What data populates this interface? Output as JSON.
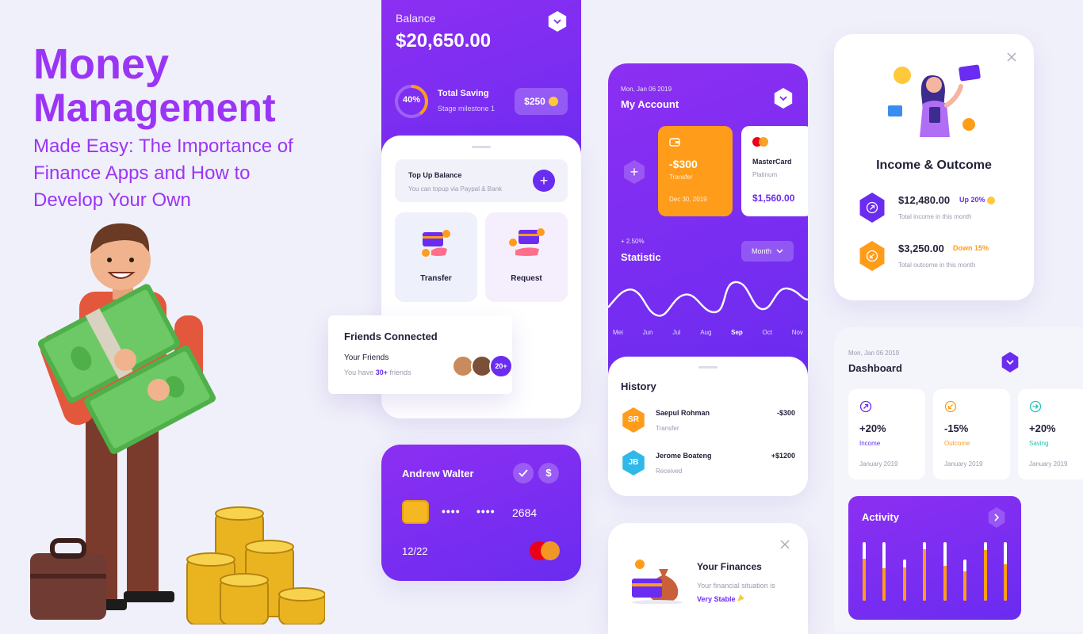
{
  "headline": {
    "title_line1": "Money",
    "title_line2": "Management",
    "sub_line1": "Made Easy: The Importance of",
    "sub_line2": "Finance Apps and How to",
    "sub_line3": "Develop Your Own"
  },
  "balance_screen": {
    "label": "Balance",
    "amount": "$20,650.00",
    "saving_percent": "40%",
    "saving_title": "Total Saving",
    "saving_sub": "Stage milestone 1",
    "saving_chip": "$250",
    "topup_title": "Top Up Balance",
    "topup_sub": "You can topup via Paypal & Bank",
    "transfer_label": "Transfer",
    "request_label": "Request"
  },
  "friends": {
    "title": "Friends Connected",
    "subtitle": "Your Friends",
    "count_prefix": "You have",
    "count_value": "30+",
    "count_suffix": "friends",
    "badge": "20+"
  },
  "card_widget": {
    "holder": "Andrew Walter",
    "dots1": "••••",
    "dots2": "••••",
    "last4": "2684",
    "expiry": "12/22"
  },
  "account_screen": {
    "date": "Mon, Jan 06 2019",
    "title": "My Account",
    "card1_amount": "-$300",
    "card1_type": "Transfer",
    "card1_date": "Dec 30, 2019",
    "card2_brand": "MasterCard",
    "card2_tier": "Platinum",
    "card2_amount": "$1,560.00",
    "stat_change": "+ 2.50%",
    "stat_title": "Statistic",
    "period_button": "Month",
    "months": [
      "Mei",
      "Jun",
      "Jul",
      "Aug",
      "Sep",
      "Oct",
      "Nov"
    ],
    "active_month": "Sep"
  },
  "history": {
    "title": "History",
    "items": [
      {
        "initials": "SR",
        "name": "Saepul Rohman",
        "type": "Transfer",
        "amount": "-$300",
        "color": "#ff9c1a"
      },
      {
        "initials": "JB",
        "name": "Jerome Boateng",
        "type": "Received",
        "amount": "+$1200",
        "color": "#2fb8e8"
      }
    ]
  },
  "finances": {
    "title": "Your Finances",
    "line1": "Your financial situation is",
    "status": "Very Stable"
  },
  "income_outcome": {
    "title": "Income & Outcome",
    "income_amount": "$12,480.00",
    "income_change": "Up 20%",
    "income_desc": "Total income in this month",
    "outcome_amount": "$3,250.00",
    "outcome_change": "Down 15%",
    "outcome_desc": "Total outcome in this month"
  },
  "dashboard": {
    "date": "Mon, Jan 06 2019",
    "title": "Dashboard",
    "stats": [
      {
        "value": "+20%",
        "label": "Income",
        "period": "January 2019",
        "color": "#6a2cf0"
      },
      {
        "value": "-15%",
        "label": "Outcome",
        "period": "January 2019",
        "color": "#ff9c1a"
      },
      {
        "value": "+20%",
        "label": "Saving",
        "period": "January 2019",
        "color": "#2bc0b4"
      }
    ],
    "activity_title": "Activity",
    "activity_levels": [
      0.72,
      0.55,
      0.82,
      0.88,
      0.6,
      0.72,
      0.86,
      0.62
    ]
  },
  "colors": {
    "purple": "#7a2ef2",
    "orange": "#ff9c1a",
    "title_purple": "#9b35f5"
  }
}
